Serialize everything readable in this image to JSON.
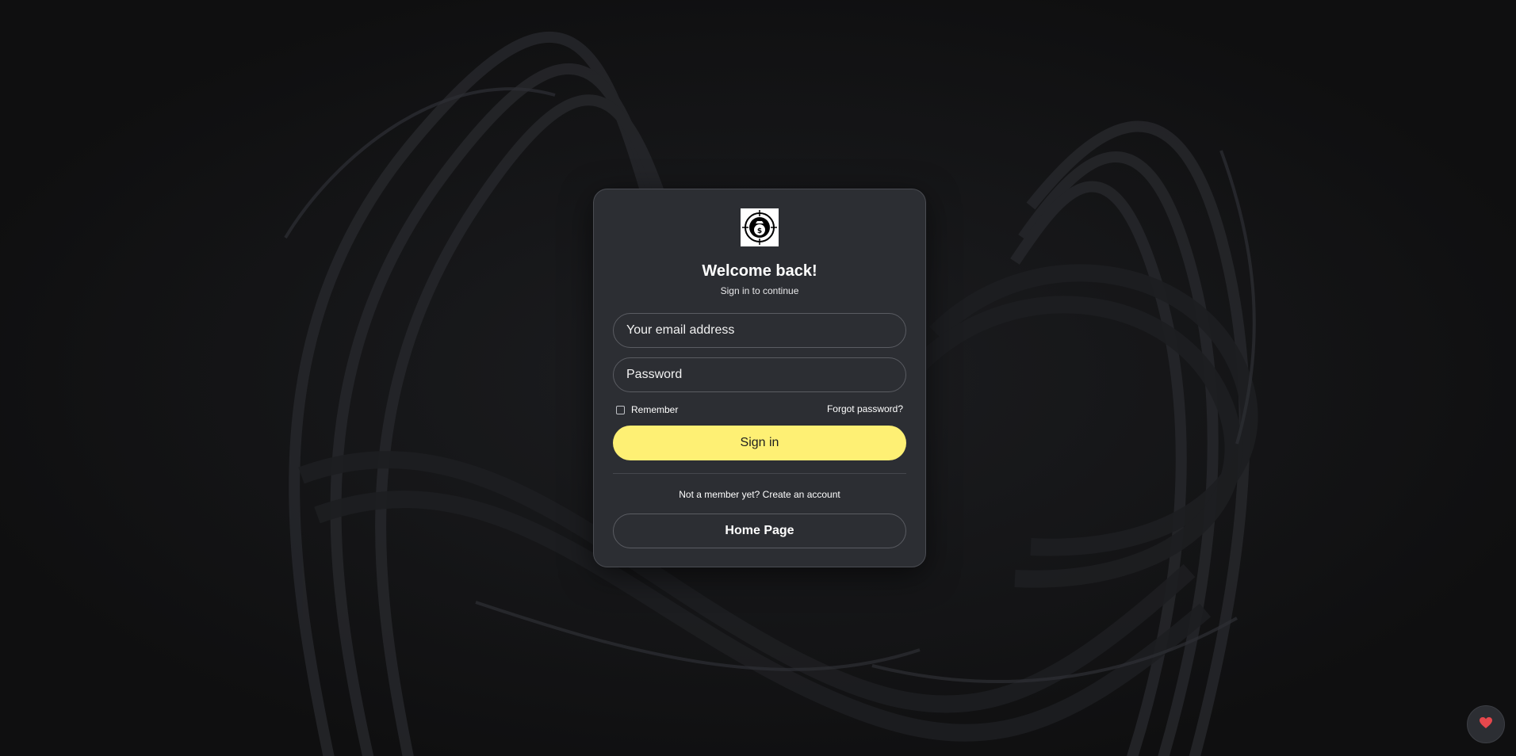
{
  "login_card": {
    "title": "Welcome back!",
    "subtitle": "Sign in to continue",
    "email_placeholder": "Your email address",
    "password_placeholder": "Password",
    "remember_label": "Remember",
    "forgot_password_label": "Forgot password?",
    "signin_label": "Sign in",
    "signup_prompt": "Not a member yet?",
    "signup_link": "Create an account",
    "home_label": "Home Page"
  },
  "icons": {
    "logo": "target-money-bag-icon",
    "favorite": "heart-icon"
  },
  "colors": {
    "background": "#0f0f10",
    "card": "#2c2e33",
    "accent": "#fef074",
    "heart": "#e5484d"
  }
}
